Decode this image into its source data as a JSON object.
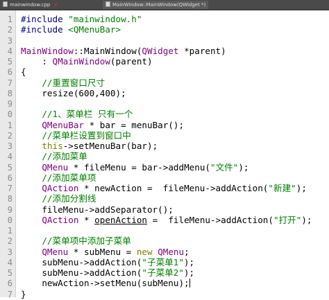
{
  "tabs": [
    {
      "label": "mainwindow.cpp",
      "active": false
    },
    {
      "label": "MainWindow::MainWindow(QWidget *)",
      "active": true
    }
  ],
  "code_lines": [
    {
      "n": "1",
      "parts": [
        [
          "pp",
          "#include "
        ],
        [
          "str",
          "\"mainwindow.h\""
        ]
      ]
    },
    {
      "n": "2",
      "parts": [
        [
          "pp",
          "#include "
        ],
        [
          "str",
          "<QMenuBar>"
        ]
      ]
    },
    {
      "n": "3",
      "parts": []
    },
    {
      "n": "4",
      "parts": [
        [
          "cls",
          "MainWindow"
        ],
        [
          "plain",
          "::MainWindow("
        ],
        [
          "cls",
          "QWidget"
        ],
        [
          "plain",
          " *parent)"
        ]
      ]
    },
    {
      "n": "5",
      "parts": [
        [
          "plain",
          "    : "
        ],
        [
          "cls",
          "QMainWindow"
        ],
        [
          "plain",
          "(parent)"
        ]
      ]
    },
    {
      "n": "6",
      "parts": [
        [
          "plain",
          "{"
        ]
      ]
    },
    {
      "n": "7",
      "parts": [
        [
          "cm",
          "    //重置窗口尺寸"
        ]
      ]
    },
    {
      "n": "8",
      "parts": [
        [
          "plain",
          "    resize(600,400);"
        ]
      ]
    },
    {
      "n": "9",
      "parts": []
    },
    {
      "n": "0",
      "parts": [
        [
          "cm",
          "    //1、菜单栏 只有一个"
        ]
      ]
    },
    {
      "n": "1",
      "parts": [
        [
          "plain",
          "    "
        ],
        [
          "cls",
          "QMenuBar"
        ],
        [
          "plain",
          " * bar = menuBar();"
        ]
      ]
    },
    {
      "n": "2",
      "parts": [
        [
          "cm",
          "    //菜单栏设置到窗口中"
        ]
      ]
    },
    {
      "n": "3",
      "parts": [
        [
          "plain",
          "    "
        ],
        [
          "kw",
          "this"
        ],
        [
          "plain",
          "->setMenuBar(bar);"
        ]
      ]
    },
    {
      "n": "4",
      "parts": [
        [
          "cm",
          "    //添加菜单"
        ]
      ]
    },
    {
      "n": "5",
      "parts": [
        [
          "plain",
          "    "
        ],
        [
          "cls",
          "QMenu"
        ],
        [
          "plain",
          " * fileMenu = bar->addMenu("
        ],
        [
          "str",
          "\"文件\""
        ],
        [
          "plain",
          ");"
        ]
      ]
    },
    {
      "n": "6",
      "parts": [
        [
          "cm",
          "    //添加菜单项"
        ]
      ]
    },
    {
      "n": "7",
      "parts": [
        [
          "plain",
          "    "
        ],
        [
          "cls",
          "QAction"
        ],
        [
          "plain",
          " * newAction =  fileMenu->addAction("
        ],
        [
          "str",
          "\"新建\""
        ],
        [
          "plain",
          ");"
        ]
      ]
    },
    {
      "n": "8",
      "parts": [
        [
          "cm",
          "    //添加分割线"
        ]
      ]
    },
    {
      "n": "9",
      "parts": [
        [
          "plain",
          "    fileMenu->addSeparator();"
        ]
      ]
    },
    {
      "n": "0",
      "parts": [
        [
          "plain",
          "    "
        ],
        [
          "cls",
          "QAction"
        ],
        [
          "plain",
          " * "
        ],
        [
          "plainu",
          "openAction"
        ],
        [
          "plain",
          " =  fileMenu->addAction("
        ],
        [
          "str",
          "\"打开\""
        ],
        [
          "plain",
          ");"
        ]
      ]
    },
    {
      "n": "1",
      "parts": []
    },
    {
      "n": "2",
      "parts": [
        [
          "cm",
          "    //菜单项中添加子菜单"
        ]
      ]
    },
    {
      "n": "3",
      "parts": [
        [
          "plain",
          "    "
        ],
        [
          "cls",
          "QMenu"
        ],
        [
          "plain",
          " * subMenu = "
        ],
        [
          "kw",
          "new"
        ],
        [
          "plain",
          " "
        ],
        [
          "cls",
          "QMenu"
        ],
        [
          "plain",
          ";"
        ]
      ]
    },
    {
      "n": "4",
      "parts": [
        [
          "plain",
          "    subMenu->addAction("
        ],
        [
          "str",
          "\"子菜单1\""
        ],
        [
          "plain",
          ");"
        ]
      ]
    },
    {
      "n": "5",
      "parts": [
        [
          "plain",
          "    subMenu->addAction("
        ],
        [
          "str",
          "\"子菜单2\""
        ],
        [
          "plain",
          ");"
        ]
      ]
    },
    {
      "n": "6",
      "parts": [
        [
          "plain",
          "    newAction->setMenu(subMenu);"
        ],
        [
          "cursor",
          ""
        ]
      ]
    },
    {
      "n": "7",
      "parts": [
        [
          "plain",
          "}"
        ]
      ]
    }
  ]
}
